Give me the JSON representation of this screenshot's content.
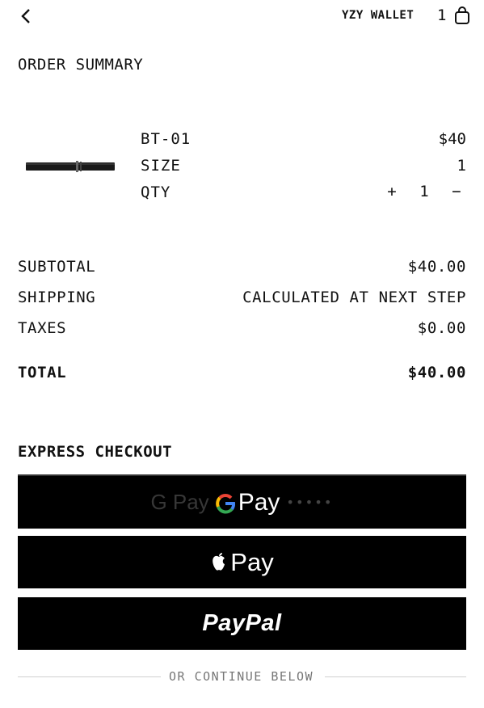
{
  "header": {
    "back_icon": "chevron-left-icon",
    "wallet_label": "YZY WALLET",
    "cart_count": "1",
    "bag_icon": "shopping-bag-icon"
  },
  "order_summary": {
    "title": "ORDER SUMMARY",
    "item": {
      "name": "BT-01",
      "price": "$40",
      "size_label": "SIZE",
      "size_value": "1",
      "qty_label": "QTY",
      "qty_plus": "+",
      "qty_value": "1",
      "qty_minus": "−"
    },
    "subtotal_label": "SUBTOTAL",
    "subtotal_value": "$40.00",
    "shipping_label": "SHIPPING",
    "shipping_value": "CALCULATED AT NEXT STEP",
    "taxes_label": "TAXES",
    "taxes_value": "$0.00",
    "total_label": "TOTAL",
    "total_value": "$40.00"
  },
  "express_checkout": {
    "title": "EXPRESS CHECKOUT",
    "gpay_faint": "G Pay",
    "gpay_g": "G",
    "gpay_pay": "Pay",
    "apple_pay_label": "Pay",
    "paypal_label": "PayPal",
    "divider_text": "OR CONTINUE BELOW"
  },
  "colors": {
    "background": "#ffffff",
    "text": "#111111",
    "button_bg": "#000000",
    "divider": "#cfcfcf"
  }
}
